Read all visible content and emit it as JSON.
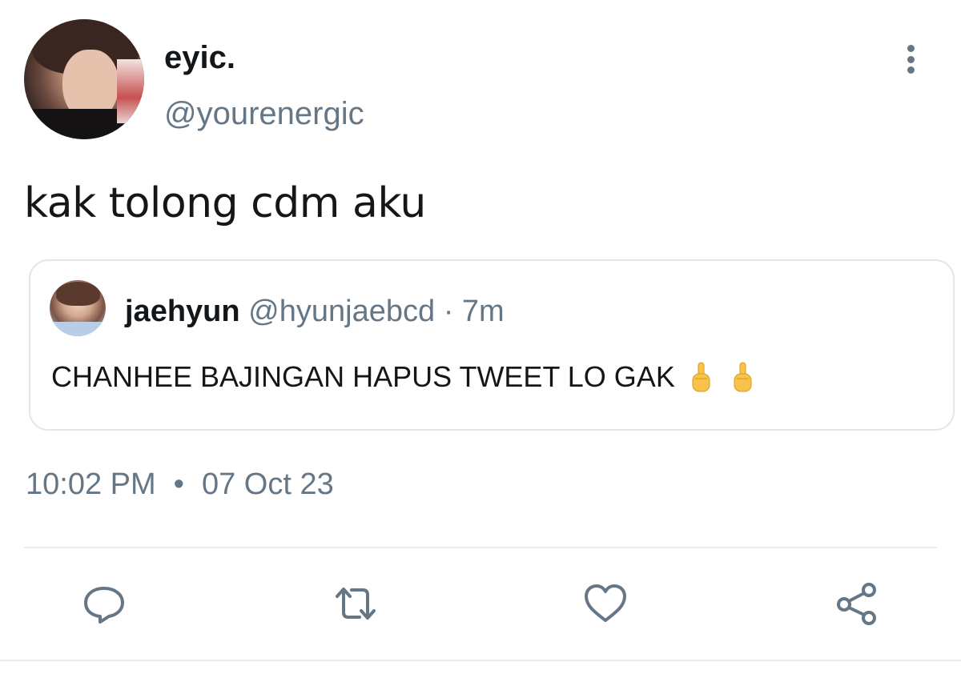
{
  "tweet": {
    "author": {
      "display_name": "eyic.",
      "handle": "@yourenergic"
    },
    "text": "kak tolong cdm aku",
    "quoted": {
      "display_name": "jaehyun",
      "handle": "@hyunjaebcd",
      "separator": "·",
      "time": "7m",
      "text": "CHANHEE BAJINGAN HAPUS TWEET LO GAK"
    },
    "time": "10:02 PM",
    "date_separator": "•",
    "date": "07 Oct 23"
  },
  "actions": [
    {
      "icon": "reply-icon"
    },
    {
      "icon": "retweet-icon"
    },
    {
      "icon": "like-icon"
    },
    {
      "icon": "share-icon"
    }
  ],
  "colors": {
    "text": "#14171a",
    "secondary": "#657786",
    "border": "#e1e8ed"
  }
}
